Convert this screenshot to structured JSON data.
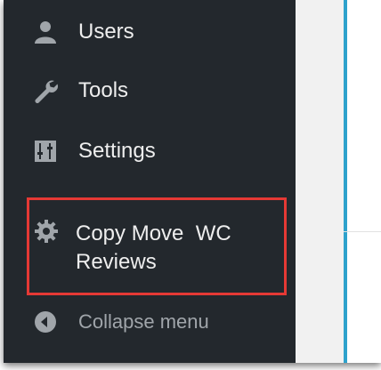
{
  "sidebar": {
    "items": [
      {
        "key": "users",
        "label": "Users",
        "icon": "users-icon"
      },
      {
        "key": "tools",
        "label": "Tools",
        "icon": "wrench-icon"
      },
      {
        "key": "settings",
        "label": "Settings",
        "icon": "settings-sliders-icon"
      }
    ],
    "highlighted_item": {
      "line1": "Copy Move  WC",
      "line2": "Reviews",
      "icon": "gear-icon",
      "highlight_color": "#e53935"
    },
    "collapse": {
      "label": "Collapse menu",
      "icon": "collapse-arrow-icon"
    }
  },
  "colors": {
    "sidebar_bg": "#23282d",
    "menu_text": "#eeeeee",
    "muted_text": "#a0a5aa",
    "accent": "#2ea2cc"
  }
}
